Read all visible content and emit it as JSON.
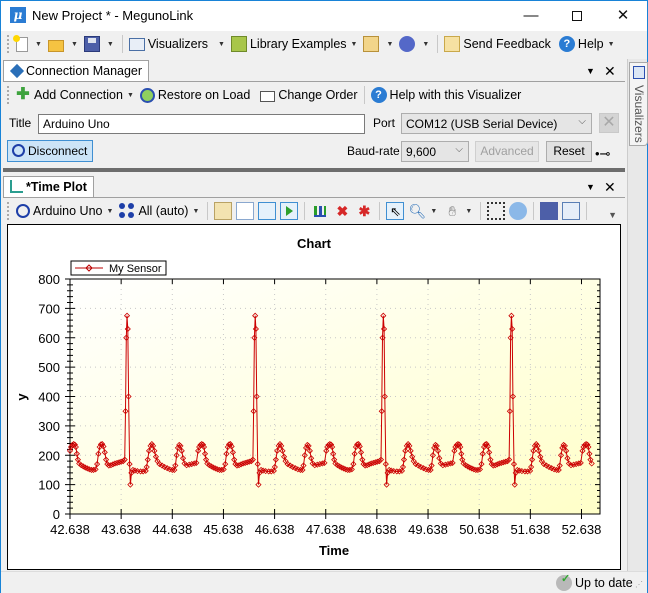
{
  "window": {
    "title": "New Project * - MegunoLink",
    "app_icon": "μ",
    "minimize": "—",
    "close": "✕"
  },
  "main_toolbar": {
    "visualizers": "Visualizers",
    "library_examples": "Library Examples",
    "send_feedback": "Send Feedback",
    "help": "Help"
  },
  "connection_manager": {
    "tab_label": "Connection Manager",
    "toolbar": {
      "add_connection": "Add Connection",
      "restore_on_load": "Restore on Load",
      "change_order": "Change Order",
      "help": "Help with this Visualizer"
    },
    "title_label": "Title",
    "title_value": "Arduino Uno",
    "port_label": "Port",
    "port_value": "COM12 (USB Serial Device)",
    "disconnect": "Disconnect",
    "baud_label": "Baud-rate",
    "baud_value": "9,600",
    "advanced": "Advanced",
    "reset": "Reset",
    "usb_icon": "•⊸"
  },
  "time_plot": {
    "tab_label": "*Time Plot",
    "toolbar": {
      "connection": "Arduino Uno",
      "channel": "All (auto)"
    }
  },
  "sidebar": {
    "visualizers_tab": "Visualizers"
  },
  "status": {
    "text": "Up to date"
  },
  "chart_data": {
    "type": "line",
    "title": "Chart",
    "xlabel": "Time",
    "ylabel": "y",
    "xlim": [
      42.638,
      53.0
    ],
    "ylim": [
      0,
      800
    ],
    "x_ticks": [
      "42.638",
      "43.638",
      "44.638",
      "45.638",
      "46.638",
      "47.638",
      "48.638",
      "49.638",
      "50.638",
      "51.638",
      "52.638"
    ],
    "y_ticks": [
      "0",
      "100",
      "200",
      "300",
      "400",
      "500",
      "600",
      "700",
      "800"
    ],
    "grid": true,
    "legend_position": "top-left",
    "series": [
      {
        "name": "My Sensor",
        "color": "#cc0000",
        "marker": "diamond",
        "period": 2.505,
        "start": 42.638,
        "end": 52.875,
        "beat_profile": [
          [
            0.0,
            215
          ],
          [
            0.02,
            228
          ],
          [
            0.045,
            235
          ],
          [
            0.07,
            238
          ],
          [
            0.095,
            236
          ],
          [
            0.115,
            228
          ],
          [
            0.135,
            205
          ],
          [
            0.155,
            185
          ],
          [
            0.18,
            172
          ],
          [
            0.22,
            166
          ],
          [
            0.26,
            162
          ],
          [
            0.3,
            158
          ],
          [
            0.34,
            155
          ],
          [
            0.38,
            152
          ],
          [
            0.42,
            150
          ],
          [
            0.46,
            150
          ],
          [
            0.5,
            152
          ],
          [
            0.53,
            170
          ],
          [
            0.555,
            205
          ],
          [
            0.58,
            228
          ],
          [
            0.605,
            237
          ],
          [
            0.63,
            238
          ],
          [
            0.655,
            230
          ],
          [
            0.68,
            210
          ],
          [
            0.705,
            185
          ],
          [
            0.73,
            170
          ],
          [
            0.76,
            165
          ],
          [
            0.8,
            166
          ],
          [
            0.84,
            169
          ],
          [
            0.88,
            172
          ],
          [
            0.92,
            174
          ],
          [
            0.96,
            176
          ],
          [
            1.0,
            178
          ],
          [
            1.04,
            180
          ],
          [
            1.07,
            185
          ],
          [
            1.085,
            350
          ],
          [
            1.1,
            600
          ],
          [
            1.115,
            675
          ],
          [
            1.13,
            630
          ],
          [
            1.145,
            400
          ],
          [
            1.165,
            170
          ],
          [
            1.18,
            100
          ],
          [
            1.2,
            140
          ],
          [
            1.23,
            150
          ],
          [
            1.27,
            148
          ],
          [
            1.32,
            146
          ],
          [
            1.38,
            145
          ],
          [
            1.43,
            145
          ],
          [
            1.48,
            147
          ],
          [
            1.5,
            160
          ],
          [
            1.52,
            185
          ],
          [
            1.545,
            215
          ],
          [
            1.575,
            232
          ],
          [
            1.6,
            238
          ],
          [
            1.625,
            232
          ],
          [
            1.65,
            215
          ],
          [
            1.68,
            195
          ],
          [
            1.71,
            180
          ],
          [
            1.75,
            170
          ],
          [
            1.8,
            165
          ],
          [
            1.85,
            160
          ],
          [
            1.9,
            156
          ],
          [
            1.95,
            152
          ],
          [
            2.0,
            150
          ],
          [
            2.04,
            150
          ],
          [
            2.06,
            165
          ],
          [
            2.085,
            200
          ],
          [
            2.11,
            225
          ],
          [
            2.135,
            235
          ],
          [
            2.16,
            232
          ],
          [
            2.185,
            215
          ],
          [
            2.21,
            190
          ],
          [
            2.24,
            172
          ],
          [
            2.28,
            166
          ],
          [
            2.33,
            168
          ],
          [
            2.38,
            170
          ],
          [
            2.43,
            172
          ],
          [
            2.47,
            174
          ]
        ]
      }
    ]
  }
}
